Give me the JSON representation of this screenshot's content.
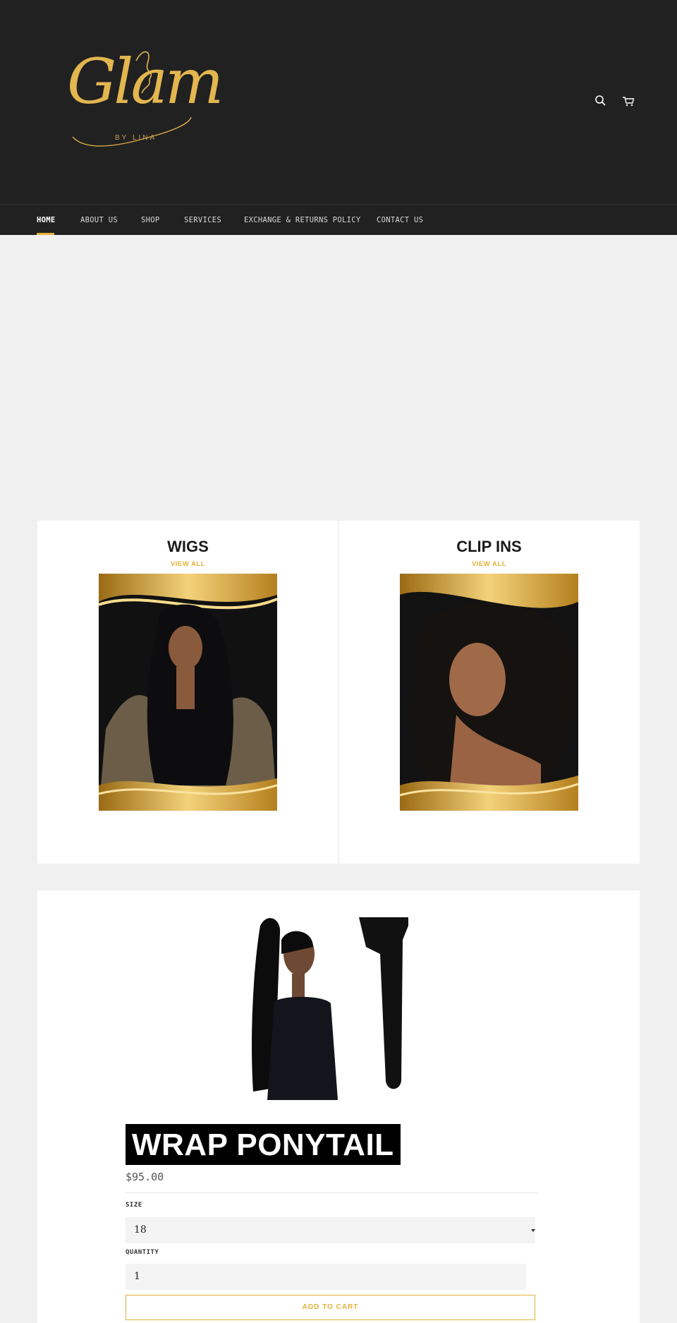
{
  "header": {
    "logo_text": "Glam",
    "logo_subtext": "BY LINA",
    "icons": [
      "search-icon",
      "cart-icon"
    ]
  },
  "nav": {
    "items": [
      {
        "label": "HOME",
        "active": true
      },
      {
        "label": "ABOUT US"
      },
      {
        "label": "SHOP"
      },
      {
        "label": "SERVICES"
      },
      {
        "label": "EXCHANGE & RETURNS POLICY"
      },
      {
        "label": "CONTACT US"
      }
    ]
  },
  "collections": [
    {
      "title": "WIGS",
      "link": "VIEW ALL"
    },
    {
      "title": "CLIP INS",
      "link": "VIEW ALL"
    }
  ],
  "product": {
    "title": "WRAP PONYTAIL",
    "price": "$95.00",
    "size_label": "SIZE",
    "size_value": "18",
    "quantity_label": "QUANTITY",
    "quantity_value": "1",
    "add_to_cart": "ADD TO CART"
  },
  "colors": {
    "header_bg": "#212121",
    "accent": "#e3b13a",
    "page_bg": "#f0f0f0"
  }
}
